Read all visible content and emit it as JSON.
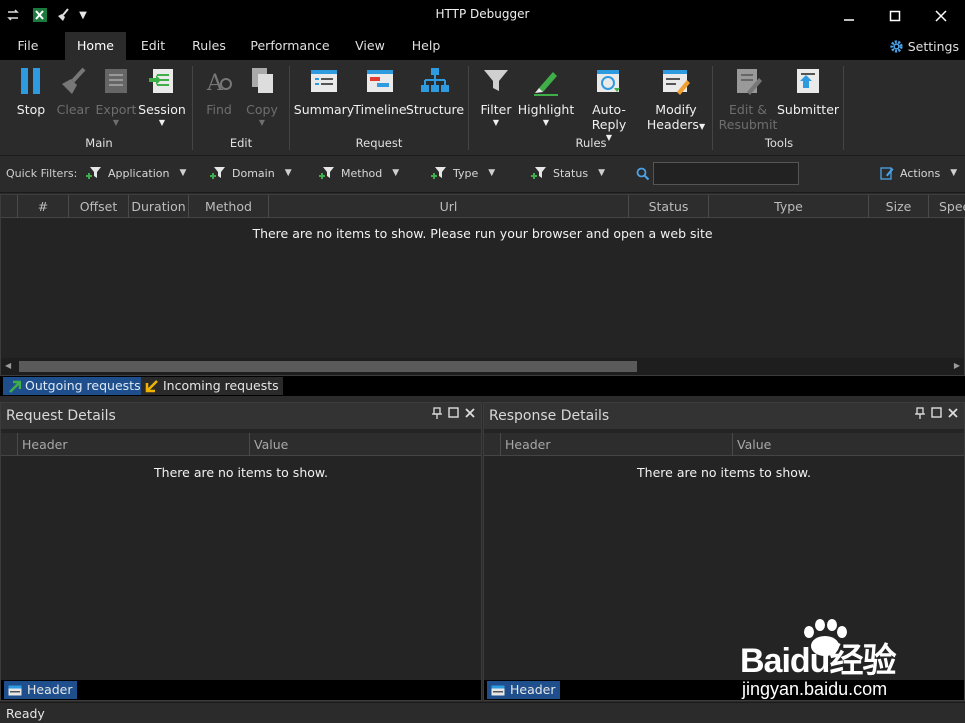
{
  "window": {
    "title": "HTTP Debugger"
  },
  "menu": {
    "tabs": [
      "File",
      "Home",
      "Edit",
      "Rules",
      "Performance",
      "View",
      "Help"
    ],
    "active": "Home",
    "settings_label": "Settings"
  },
  "ribbon": {
    "stop": "Stop",
    "clear": "Clear",
    "export": "Export",
    "session": "Session",
    "main_group": "Main",
    "find": "Find",
    "copy": "Copy",
    "edit_group": "Edit",
    "summary": "Summary",
    "timeline": "Timeline",
    "structure": "Structure",
    "request_group": "Request",
    "filter": "Filter",
    "highlight": "Highlight",
    "auto_reply": "Auto-Reply",
    "modify_1": "Modify",
    "modify_2": "Headers",
    "rules_group": "Rules",
    "edit_resubmit_1": "Edit &",
    "edit_resubmit_2": "Resubmit",
    "submitter": "Submitter",
    "tools_group": "Tools"
  },
  "quick_filters": {
    "label": "Quick Filters:",
    "application": "Application",
    "domain": "Domain",
    "method": "Method",
    "type": "Type",
    "status": "Status",
    "actions": "Actions",
    "search_value": ""
  },
  "grid": {
    "columns": [
      "#",
      "Offset",
      "Duration",
      "Method",
      "Url",
      "Status",
      "Type",
      "Size",
      "Spee"
    ],
    "empty_text": "There are no items to show. Please run your browser and open a web site"
  },
  "request_tabs": {
    "outgoing": "Outgoing requests",
    "incoming": "Incoming requests"
  },
  "request_details": {
    "title": "Request Details",
    "columns": [
      "Header",
      "Value"
    ],
    "empty_text": "There are no items to show.",
    "footer_tab": "Header"
  },
  "response_details": {
    "title": "Response Details",
    "columns": [
      "Header",
      "Value"
    ],
    "empty_text": "There are no items to show.",
    "footer_tab": "Header"
  },
  "status": {
    "text": "Ready"
  },
  "watermark": {
    "brand": "Baidu经验",
    "url": "jingyan.baidu.com"
  },
  "colors": {
    "accent": "#1e4f8c",
    "icon_blue": "#2e9be0",
    "icon_green": "#3fae49"
  }
}
